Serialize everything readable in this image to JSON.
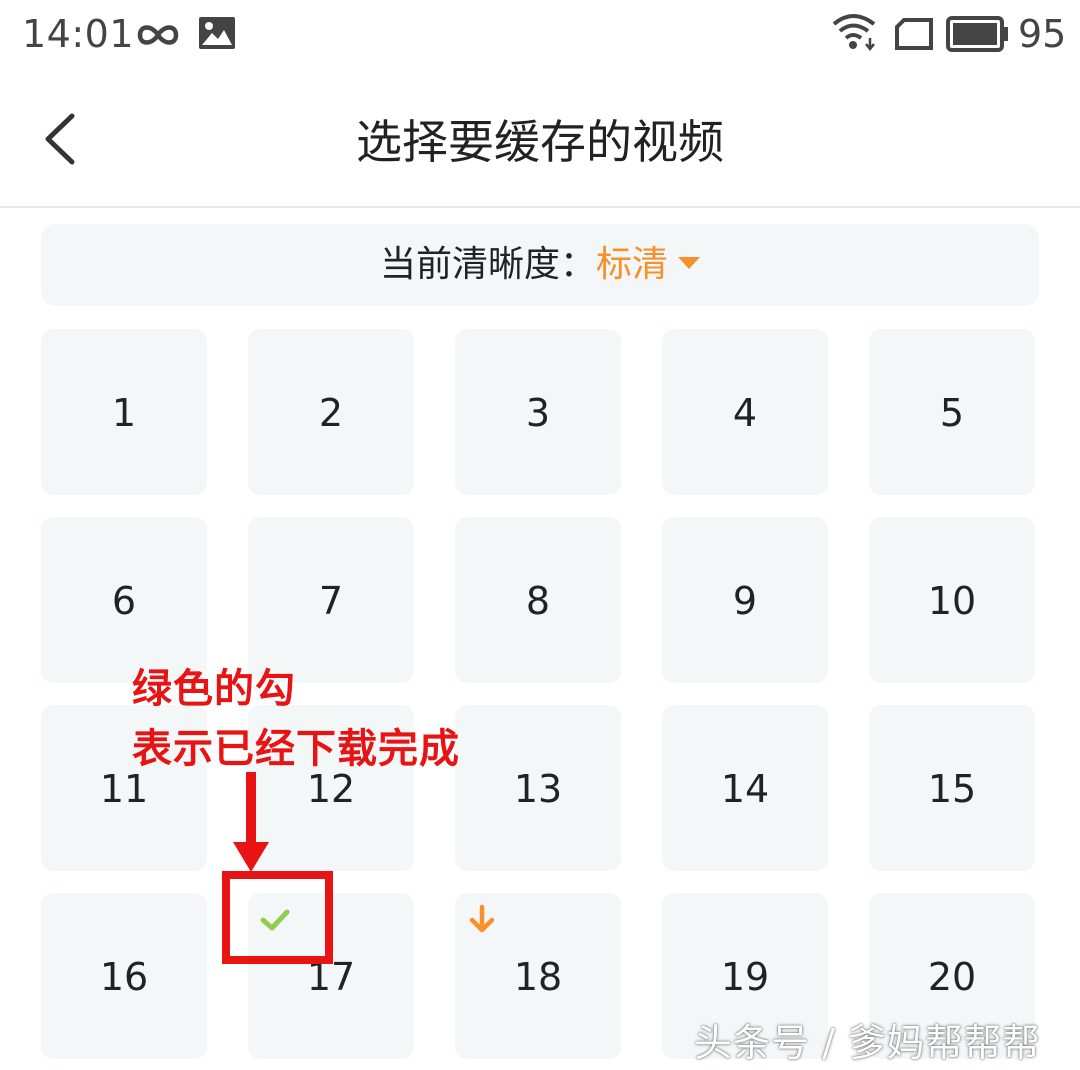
{
  "status_bar": {
    "time": "14:01",
    "battery": "95",
    "icons": [
      "infinity-icon",
      "image-icon",
      "wifi-icon",
      "sim-icon",
      "battery-icon"
    ]
  },
  "nav": {
    "title": "选择要缓存的视频",
    "back_icon": "chevron-left-icon"
  },
  "quality": {
    "label": "当前清晰度：",
    "value": "标清",
    "caret_icon": "caret-down-icon"
  },
  "episodes": [
    {
      "number": "1",
      "status": "none"
    },
    {
      "number": "2",
      "status": "none"
    },
    {
      "number": "3",
      "status": "none"
    },
    {
      "number": "4",
      "status": "none"
    },
    {
      "number": "5",
      "status": "none"
    },
    {
      "number": "6",
      "status": "none"
    },
    {
      "number": "7",
      "status": "none"
    },
    {
      "number": "8",
      "status": "none"
    },
    {
      "number": "9",
      "status": "none"
    },
    {
      "number": "10",
      "status": "none"
    },
    {
      "number": "11",
      "status": "none"
    },
    {
      "number": "12",
      "status": "none"
    },
    {
      "number": "13",
      "status": "none"
    },
    {
      "number": "14",
      "status": "none"
    },
    {
      "number": "15",
      "status": "none"
    },
    {
      "number": "16",
      "status": "none"
    },
    {
      "number": "17",
      "status": "downloaded"
    },
    {
      "number": "18",
      "status": "downloading"
    },
    {
      "number": "19",
      "status": "none"
    },
    {
      "number": "20",
      "status": "none"
    }
  ],
  "annotation": {
    "line1": "绿色的勾",
    "line2": "表示已经下载完成"
  },
  "watermark": "头条号 / 爹妈帮帮帮",
  "colors": {
    "accent": "#f7902a",
    "downloaded": "#8fce4f",
    "annotation": "#e81313",
    "cell_bg": "#f4f7f8"
  }
}
